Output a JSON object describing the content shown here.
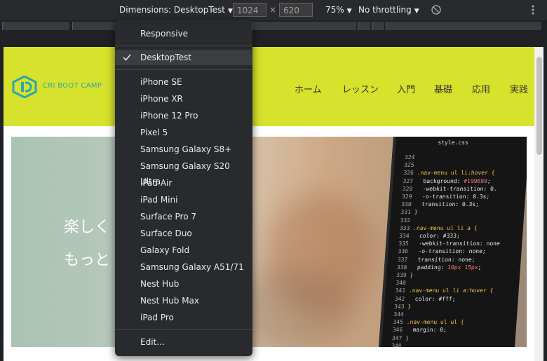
{
  "toolbar": {
    "dimensions_label": "Dimensions: DesktopTest",
    "width": "1024",
    "height": "620",
    "times": "×",
    "zoom": "75%",
    "throttling": "No throttling"
  },
  "menu": {
    "responsive": "Responsive",
    "selected": "DesktopTest",
    "devices": [
      "iPhone SE",
      "iPhone XR",
      "iPhone 12 Pro",
      "Pixel 5",
      "Samsung Galaxy S8+",
      "Samsung Galaxy S20 Ultra",
      "iPad Air",
      "iPad Mini",
      "Surface Pro 7",
      "Surface Duo",
      "Galaxy Fold",
      "Samsung Galaxy A51/71",
      "Nest Hub",
      "Nest Hub Max",
      "iPad Pro"
    ],
    "edit": "Edit..."
  },
  "site": {
    "logo_text": "CRI BOOT CAMP",
    "nav": [
      "ホーム",
      "レッスン",
      "入門",
      "基礎",
      "応用",
      "実践"
    ],
    "hero_line1": "楽しく",
    "hero_line2": "もっと",
    "code_tab": "style.css"
  },
  "colors": {
    "header_bg": "#d6e22b",
    "logo": "#2aa5b2",
    "devtools_bg": "#292a2d"
  }
}
